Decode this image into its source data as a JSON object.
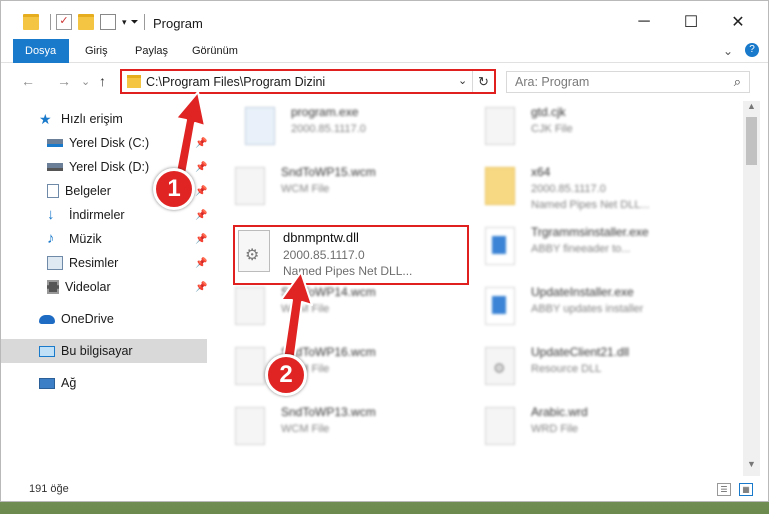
{
  "window": {
    "title": "Program",
    "minimize": "─",
    "maximize": "☐",
    "close": "✕"
  },
  "ribbon": {
    "tabs": [
      "Dosya",
      "Giriş",
      "Paylaş",
      "Görünüm"
    ],
    "expand": "⌄",
    "help": "?"
  },
  "nav": {
    "back": "←",
    "forward": "→",
    "recent": "⌄",
    "up": "↑",
    "address": "C:\\Program Files\\Program Dizini",
    "address_chevron": "⌄",
    "refresh": "↻",
    "search_placeholder": "Ara: Program",
    "search_icon": "🔍"
  },
  "sidebar": {
    "items": [
      {
        "label": "Hızlı erişim",
        "icon": "star-icon",
        "pinned": false
      },
      {
        "label": "Yerel Disk (C:)",
        "icon": "drive-icon",
        "pinned": true
      },
      {
        "label": "Yerel Disk (D:)",
        "icon": "drive-icon",
        "pinned": true
      },
      {
        "label": "Belgeler",
        "icon": "documents-icon",
        "pinned": true
      },
      {
        "label": "İndirmeler",
        "icon": "download-icon",
        "pinned": true
      },
      {
        "label": "Müzik",
        "icon": "music-icon",
        "pinned": true
      },
      {
        "label": "Resimler",
        "icon": "pictures-icon",
        "pinned": true
      },
      {
        "label": "Videolar",
        "icon": "video-icon",
        "pinned": true
      },
      {
        "label": "OneDrive",
        "icon": "cloud-icon",
        "pinned": false
      },
      {
        "label": "Bu bilgisayar",
        "icon": "computer-icon",
        "pinned": false
      },
      {
        "label": "Ağ",
        "icon": "network-icon",
        "pinned": false
      }
    ],
    "pin_glyph": "📌"
  },
  "files": [
    {
      "name": "program.exe",
      "line2": "2000.85.1117.0",
      "line3": "",
      "icon": "exe"
    },
    {
      "name": "gtd.cjk",
      "line2": "CJK File",
      "line3": "",
      "icon": "file"
    },
    {
      "name": "SndToWP15.wcm",
      "line2": "WCM File",
      "line3": "",
      "icon": "file"
    },
    {
      "name": "x64",
      "line2": "2000.85.1117.0",
      "line3": "Named Pipes Net DLL...",
      "icon": "folder"
    },
    {
      "name": "Trgrammsinstaller.exe",
      "line2": "ABBY fineeader to...",
      "line3": "",
      "icon": "installer"
    },
    {
      "name": "SndToWP14.wcm",
      "line2": "WCM File",
      "line3": "",
      "icon": "file"
    },
    {
      "name": "UpdateInstaller.exe",
      "line2": "ABBY updates installer",
      "line3": "",
      "icon": "installer"
    },
    {
      "name": "SndToWP16.wcm",
      "line2": "WCM File",
      "line3": "",
      "icon": "file"
    },
    {
      "name": "UpdateClient21.dll",
      "line2": "Resource DLL",
      "line3": "",
      "icon": "gear"
    },
    {
      "name": "SndToWP13.wcm",
      "line2": "WCM File",
      "line3": "",
      "icon": "file"
    },
    {
      "name": "Arabic.wrd",
      "line2": "WRD File",
      "line3": "",
      "icon": "file"
    }
  ],
  "highlighted_file": {
    "name": "dbnmpntw.dll",
    "version": "2000.85.1117.0",
    "description": "Named Pipes Net DLL..."
  },
  "status": {
    "count": "191 öğe"
  },
  "annotations": [
    "1",
    "2"
  ],
  "colors": {
    "accent": "#1979ca",
    "highlight_border": "#e0201f",
    "badge": "#e02424"
  }
}
